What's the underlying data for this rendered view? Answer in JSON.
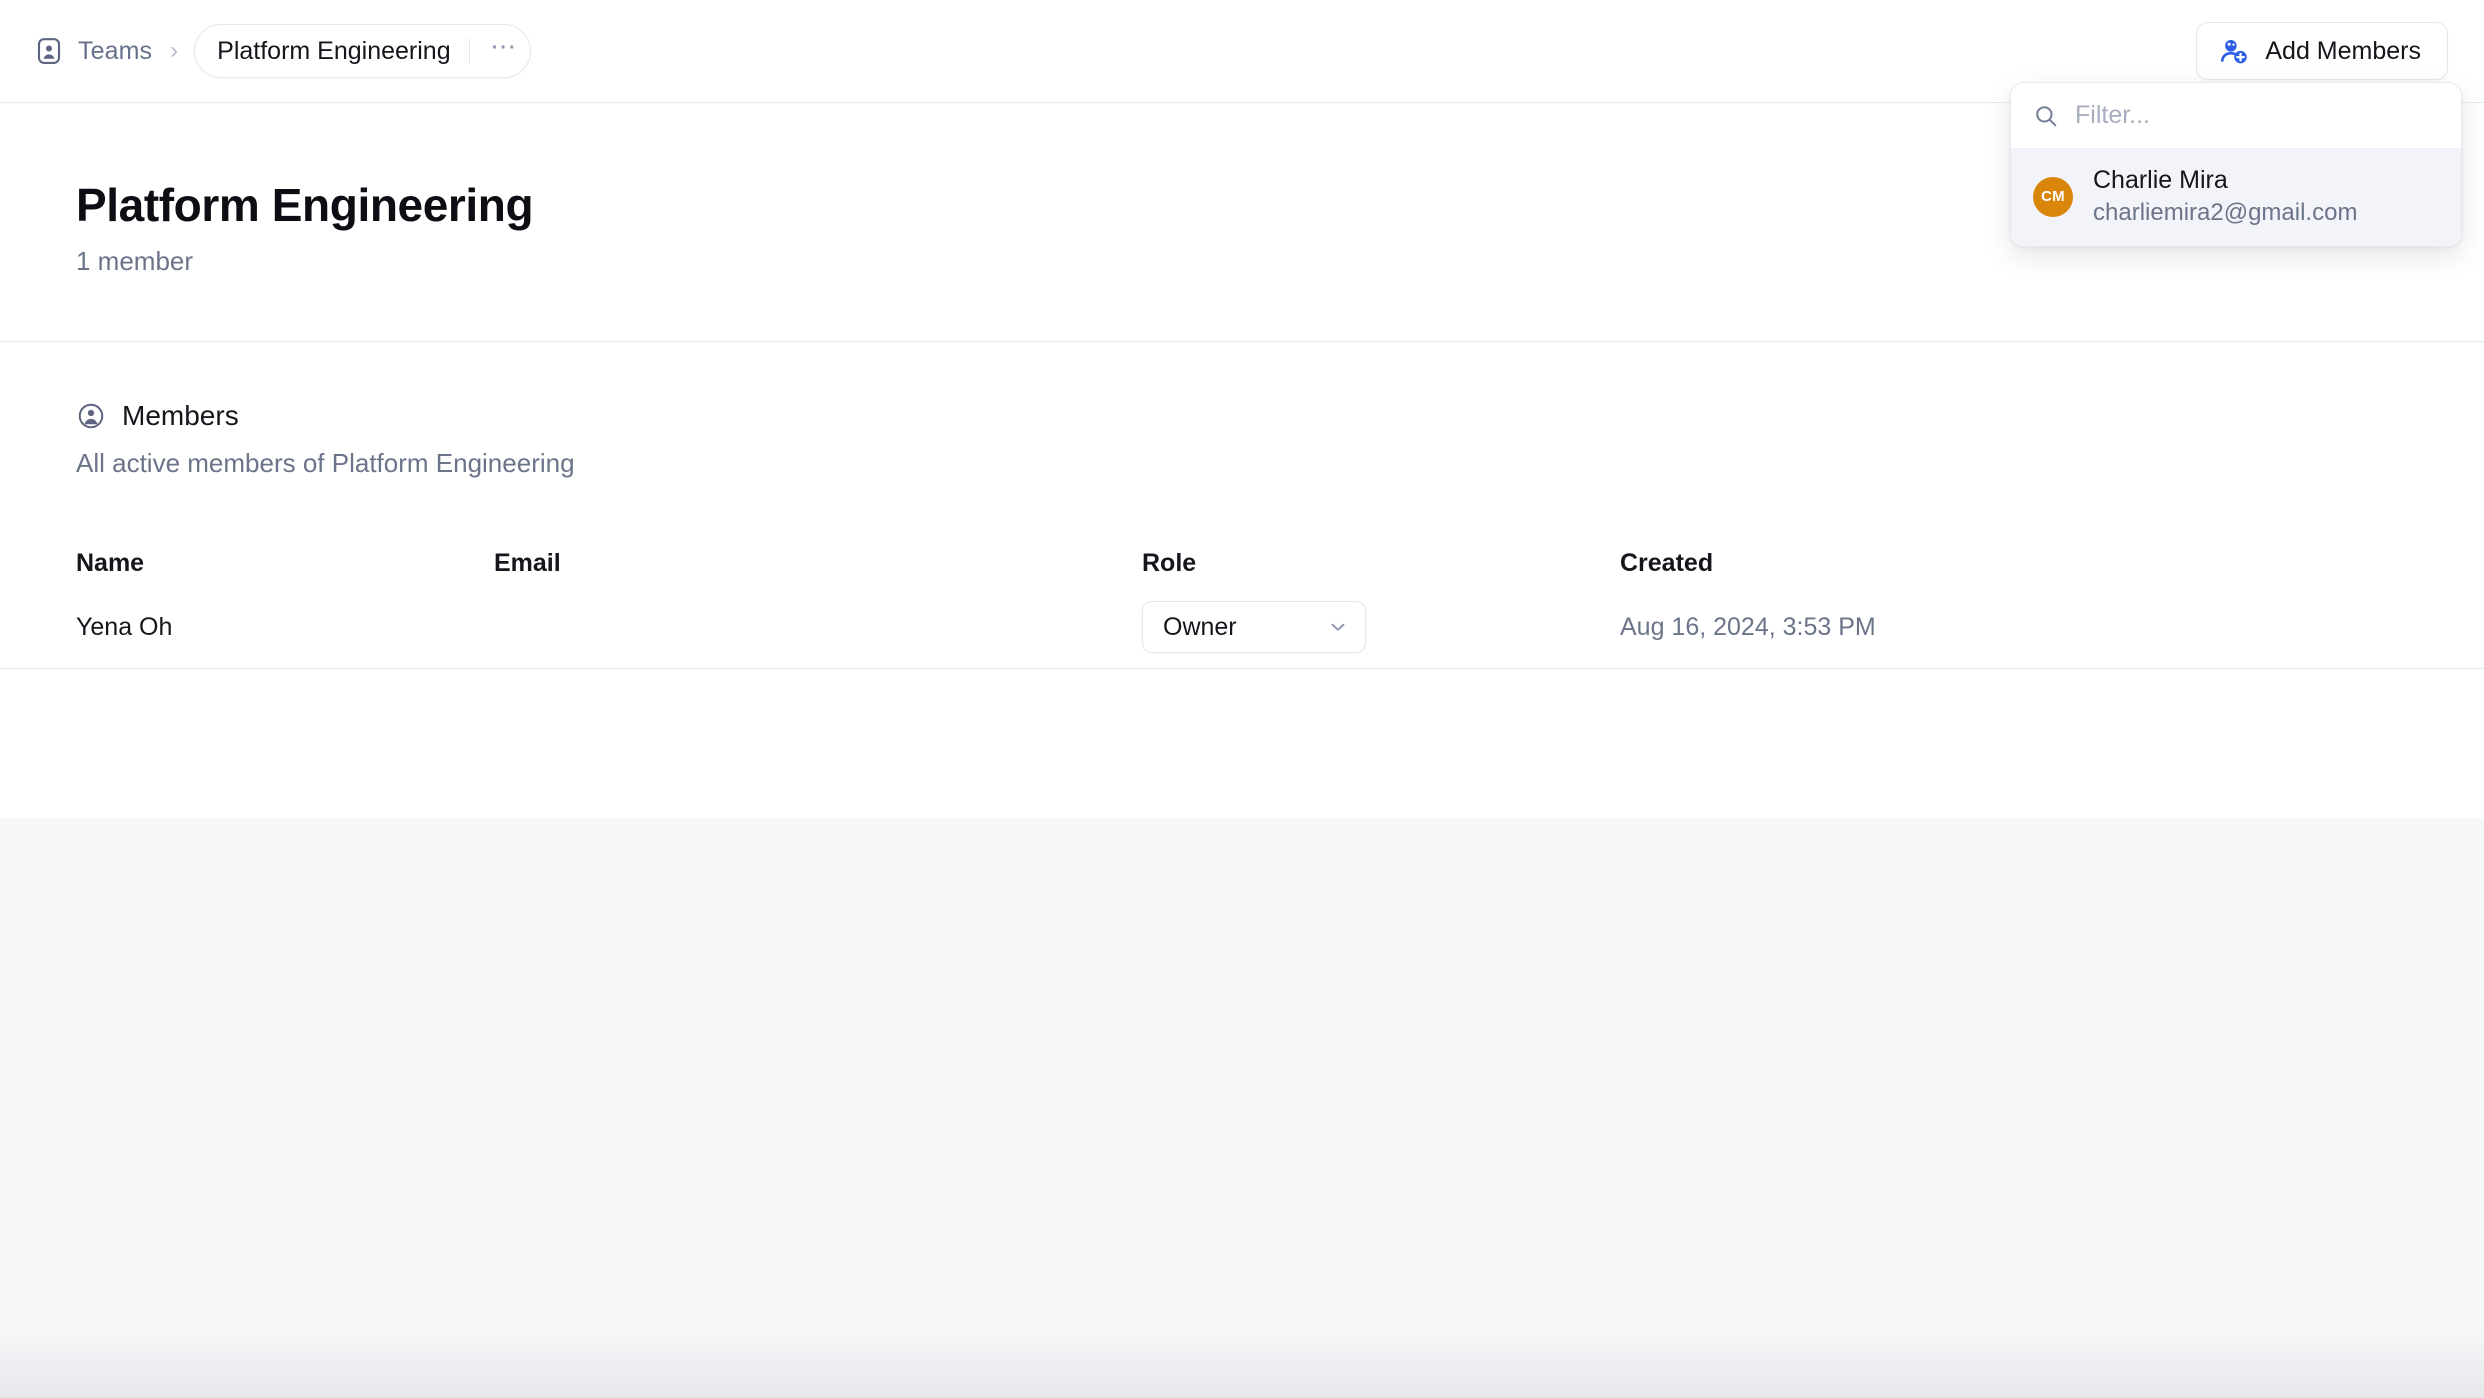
{
  "topbar": {
    "crumb_icon": "contact-card-icon",
    "teams_label": "Teams",
    "separator": "›",
    "team_chip_label": "Platform Engineering",
    "chip_menu_label": "⋯",
    "add_members_label": "Add Members",
    "add_members_icon": "person-add-icon",
    "accent_blue": "#2b5ce6"
  },
  "dropdown": {
    "search_icon": "search-icon",
    "filter_value": "",
    "filter_placeholder": "Filter...",
    "results": [
      {
        "initials": "CM",
        "name": "Charlie Mira",
        "email": "charliemira2@gmail.com",
        "avatar_color": "#d9860b"
      }
    ]
  },
  "page": {
    "title": "Platform Engineering",
    "subtitle": "1 member"
  },
  "section": {
    "icon": "user-circle-icon",
    "title": "Members",
    "description": "All active members of Platform Engineering"
  },
  "table": {
    "headers": {
      "name": "Name",
      "email": "Email",
      "role": "Role",
      "created": "Created"
    },
    "rows": [
      {
        "name": "Yena Oh",
        "email": "",
        "role": "Owner",
        "created": "Aug 16, 2024, 3:53 PM"
      }
    ]
  }
}
